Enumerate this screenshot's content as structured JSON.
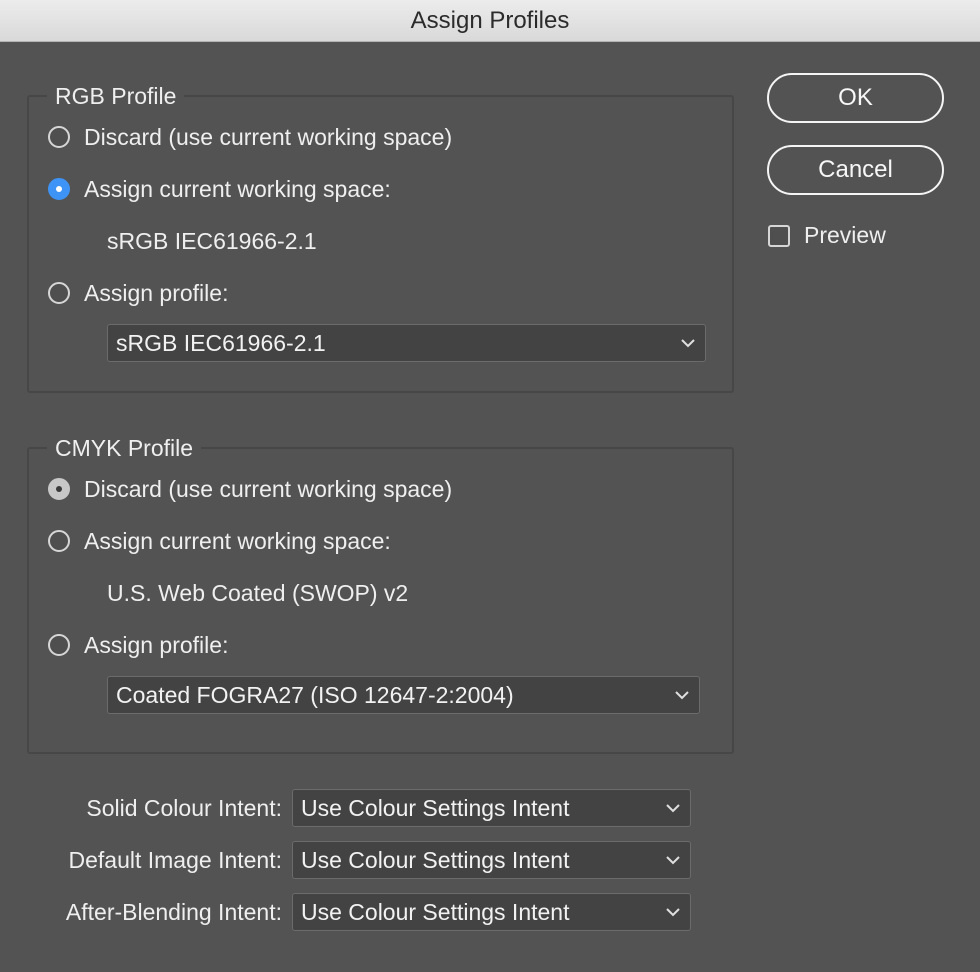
{
  "window": {
    "title": "Assign Profiles"
  },
  "rgb": {
    "title": "RGB Profile",
    "options": [
      {
        "label": "Discard (use current working space)"
      },
      {
        "label": "Assign current working space:"
      },
      {
        "label": "Assign profile:"
      }
    ],
    "selected_index": 1,
    "current_space": "sRGB IEC61966-2.1",
    "profile_select": "sRGB IEC61966-2.1"
  },
  "cmyk": {
    "title": "CMYK Profile",
    "options": [
      {
        "label": "Discard (use current working space)"
      },
      {
        "label": "Assign current working space:"
      },
      {
        "label": "Assign profile:"
      }
    ],
    "selected_index": 0,
    "current_space": "U.S. Web Coated (SWOP) v2",
    "profile_select": "Coated FOGRA27 (ISO 12647-2:2004)"
  },
  "buttons": {
    "ok": "OK",
    "cancel": "Cancel"
  },
  "preview": {
    "label": "Preview",
    "checked": false
  },
  "intents": [
    {
      "label": "Solid Colour Intent:",
      "value": "Use Colour Settings Intent"
    },
    {
      "label": "Default Image Intent:",
      "value": "Use Colour Settings Intent"
    },
    {
      "label": "After-Blending Intent:",
      "value": "Use Colour Settings Intent"
    }
  ],
  "colors": {
    "accent": "#3d94f6",
    "background": "#535353"
  }
}
